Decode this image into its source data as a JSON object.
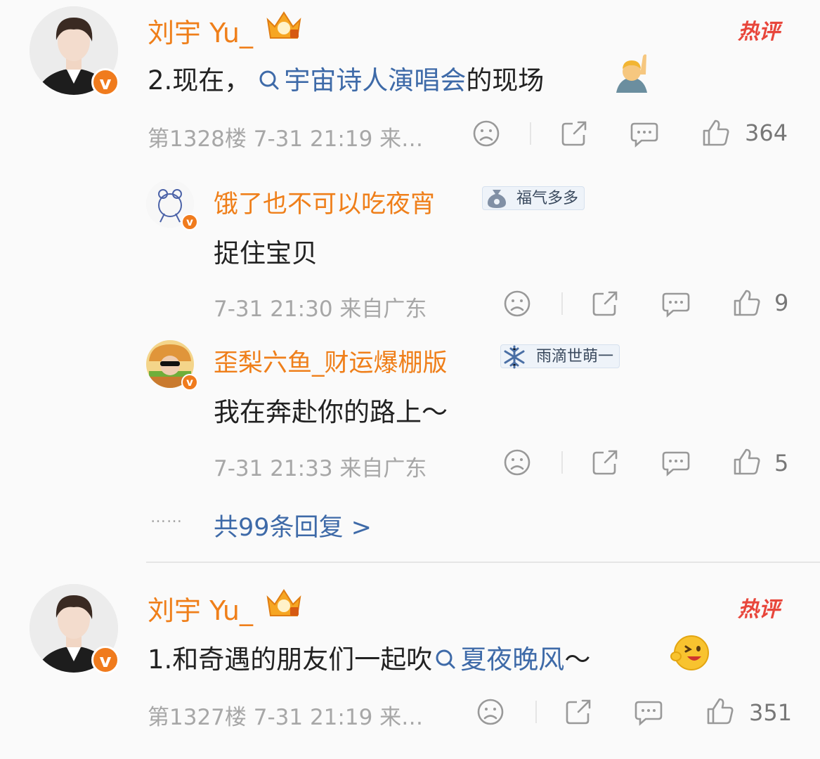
{
  "comments": [
    {
      "username": "刘宇 Yu_",
      "hot_label": "热评",
      "text_before": "2.现在，",
      "topic": "宇宙诗人演唱会",
      "text_after": "的现场",
      "floor_meta": "第1328楼 7-31 21:19 来…",
      "likes": "364",
      "replies": [
        {
          "username": "饿了也不可以吃夜宵",
          "badge": "福气多多",
          "text": "捉住宝贝",
          "meta": "7-31 21:30 来自广东",
          "likes": "9"
        },
        {
          "username": "歪梨六鱼_财运爆棚版",
          "badge": "雨滴世萌一",
          "text": "我在奔赴你的路上～",
          "meta": "7-31 21:33 来自广东",
          "likes": "5"
        }
      ],
      "more_replies_dots": "……",
      "more_replies": "共99条回复 >"
    },
    {
      "username": "刘宇 Yu_",
      "hot_label": "热评",
      "text_before": "1.和奇遇的朋友们一起吹",
      "topic": "夏夜晚风",
      "text_after": "～",
      "floor_meta": "第1327楼 7-31 21:19 来…",
      "likes": "351"
    }
  ],
  "colors": {
    "username": "#ef7f1a",
    "topic": "#3e6aa8",
    "meta": "#a7a7a7",
    "hot": "#e8463b",
    "verified": "#f07b1d"
  }
}
